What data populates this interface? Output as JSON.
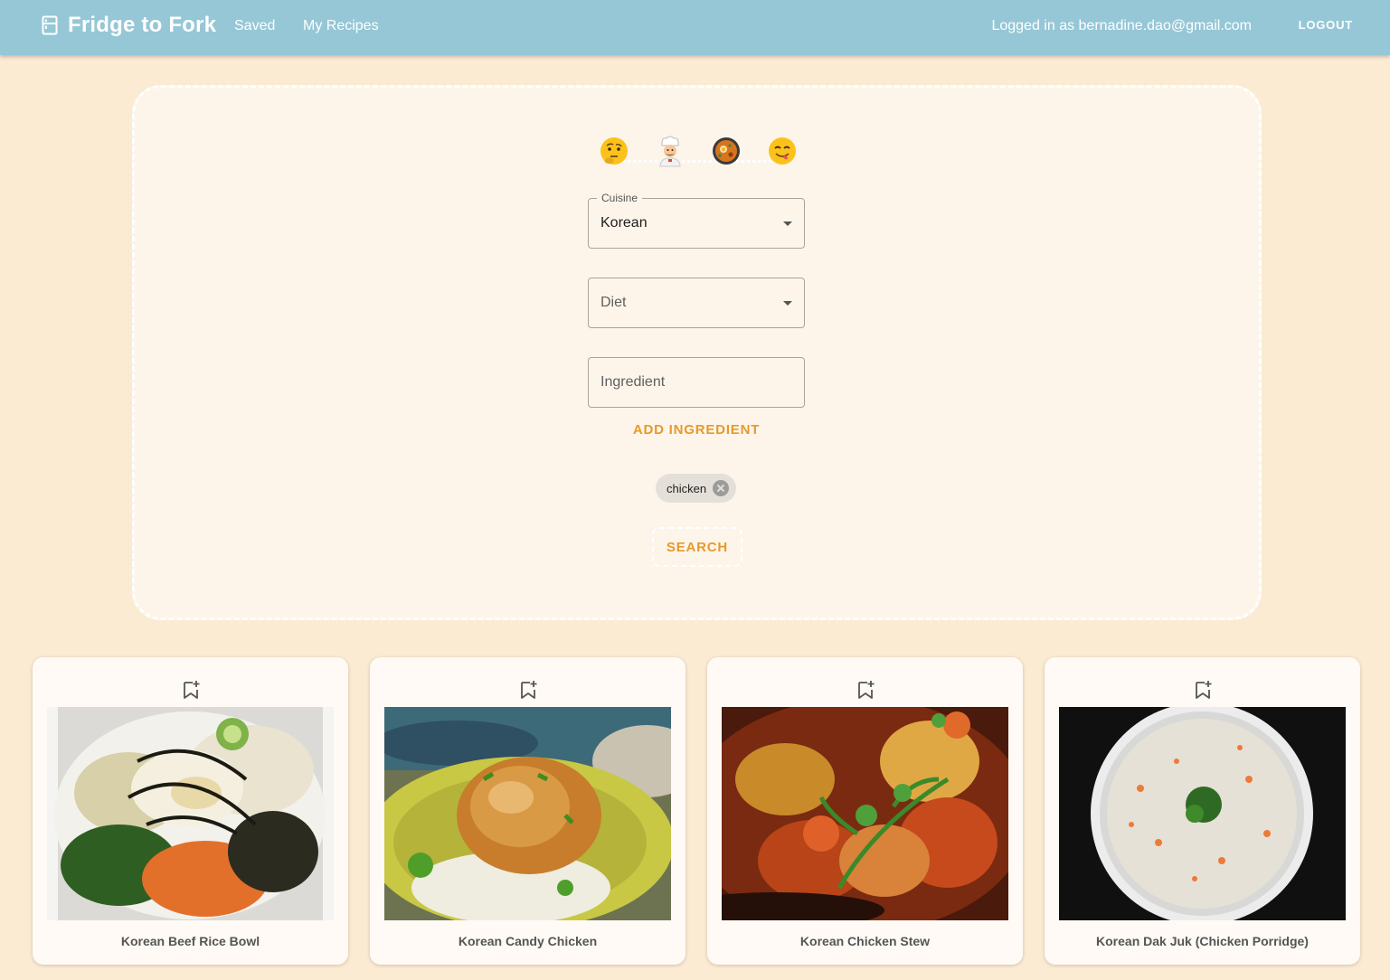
{
  "app": {
    "title": "Fridge to Fork"
  },
  "nav": {
    "saved": "Saved",
    "my_recipes": "My Recipes"
  },
  "user": {
    "logged_in_text": "Logged in as bernadine.dao@gmail.com",
    "logout": "LOGOUT"
  },
  "icons": {
    "brand": "fridge-icon",
    "emojis": [
      "thinking-face-icon",
      "cook-icon",
      "shallow-pan-of-food-icon",
      "face-savoring-food-icon"
    ],
    "chip_delete": "cancel-icon",
    "card_save": "bookmark-add-icon"
  },
  "search": {
    "cuisine_label": "Cuisine",
    "cuisine_value": "Korean",
    "diet_placeholder": "Diet",
    "ingredient_placeholder": "Ingredient",
    "add_ingredient": "ADD INGREDIENT",
    "chips": [
      "chicken"
    ],
    "search_button": "SEARCH"
  },
  "results": [
    {
      "title": "Korean Beef Rice Bowl"
    },
    {
      "title": "Korean Candy Chicken"
    },
    {
      "title": "Korean Chicken Stew"
    },
    {
      "title": "Korean Dak Juk (Chicken Porridge)"
    }
  ],
  "colors": {
    "appbar": "#96c7d6",
    "background": "#fbebd3",
    "panel": "#fdf5ea",
    "accent": "#e69a2d"
  }
}
